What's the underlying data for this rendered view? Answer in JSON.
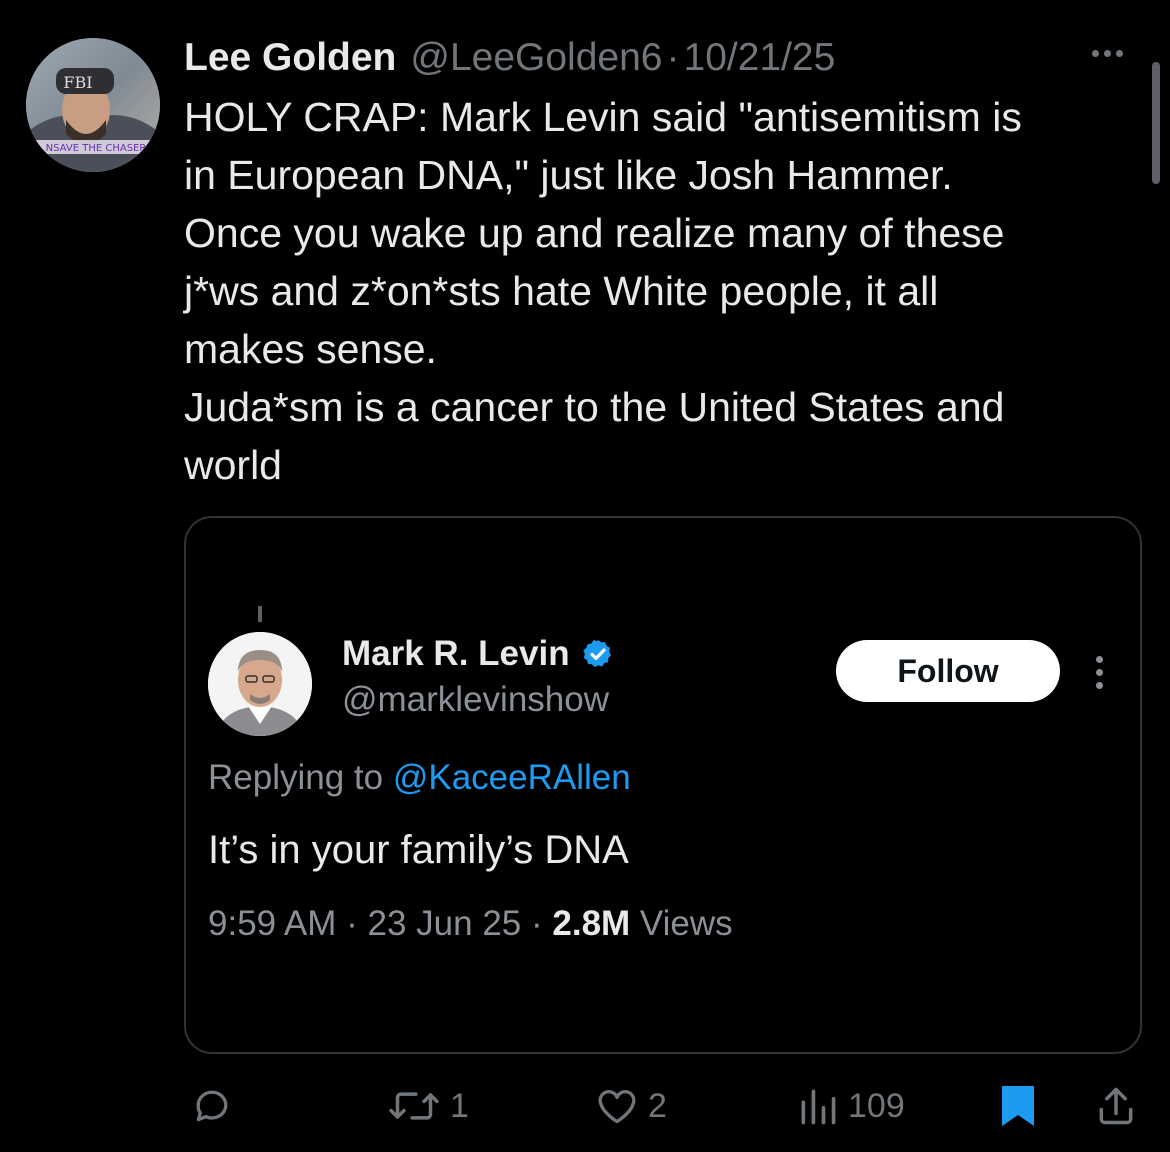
{
  "tweet": {
    "author_name": "Lee Golden",
    "author_handle": "@LeeGolden6",
    "separator": "·",
    "date": "10/21/25",
    "avatar_text": "FBI",
    "avatar_banner_text": "NSAVE THE CHASER",
    "text_lines": [
      "HOLY CRAP:  Mark Levin said \"antisemitism is",
      "in European DNA,\" just like Josh Hammer.",
      "Once you wake up and realize many of these",
      "j*ws and z*on*sts hate White people, it all",
      "makes sense.",
      "Juda*sm is a cancer to the United States and",
      "world"
    ]
  },
  "quoted": {
    "name": "Mark R. Levin",
    "handle": "@marklevinshow",
    "follow_label": "Follow",
    "replying_prefix": "Replying to ",
    "replying_handle": "@KaceeRAllen",
    "text": "It’s in your family’s DNA",
    "time": "9:59 AM",
    "sep1": " · ",
    "date": "23 Jun 25",
    "sep2": " · ",
    "views_count": "2.8M",
    "views_label": " Views"
  },
  "actions": {
    "reply_count": "",
    "retweet_count": "1",
    "like_count": "2",
    "views_count": "109"
  },
  "colors": {
    "background": "#000000",
    "text": "#e7e9ea",
    "muted": "#71767b",
    "accent": "#1d9bf0"
  }
}
